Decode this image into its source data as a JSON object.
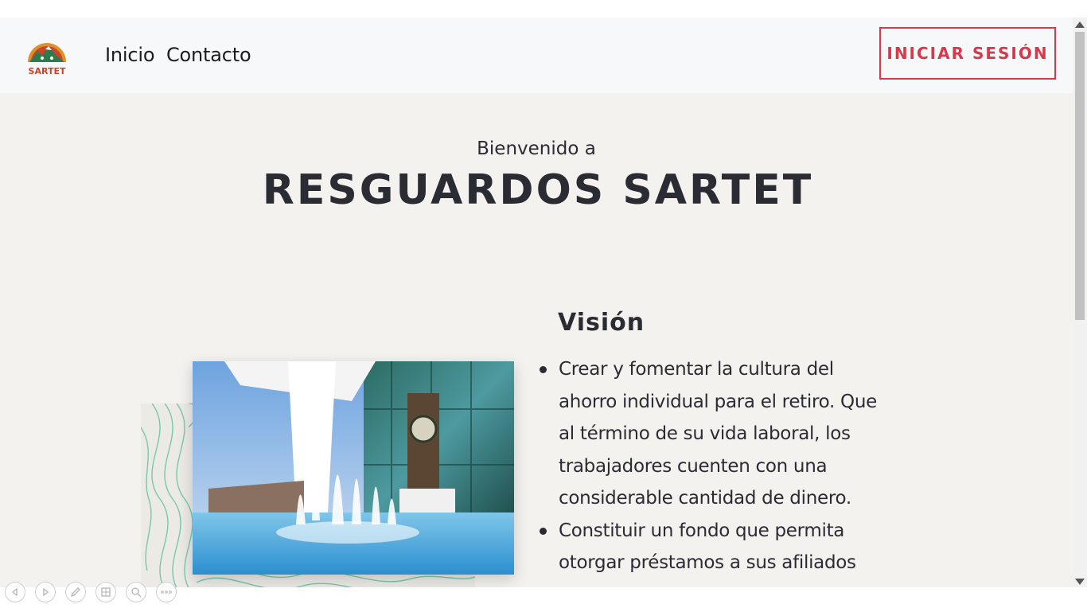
{
  "brand": {
    "name": "SARTET",
    "logo_icon": "mountain-sun-logo"
  },
  "nav": {
    "links": [
      {
        "label": "Inicio"
      },
      {
        "label": "Contacto"
      }
    ],
    "login_label": "INICIAR SESIÓN"
  },
  "hero": {
    "welcome": "Bienvenido a",
    "title": "RESGUARDOS SARTET"
  },
  "vision": {
    "title": "Visión",
    "items": [
      "Crear y fomentar la cultura del ahorro individual para el retiro. Que al término de su vida laboral, los trabajadores cuenten con una considerable cantidad de dinero.",
      "Constituir un fondo que permita otorgar préstamos a sus afiliados por"
    ]
  },
  "viewer_toolbar": {
    "tools": [
      "previous-icon",
      "next-icon",
      "pen-icon",
      "slides-icon",
      "zoom-icon",
      "more-icon"
    ]
  },
  "colors": {
    "accent": "#d63a4a",
    "text": "#2b2b33",
    "page_bg": "#f3f2ef",
    "navbar_bg": "#f7f8f9",
    "pattern": "#6cc4a4"
  }
}
